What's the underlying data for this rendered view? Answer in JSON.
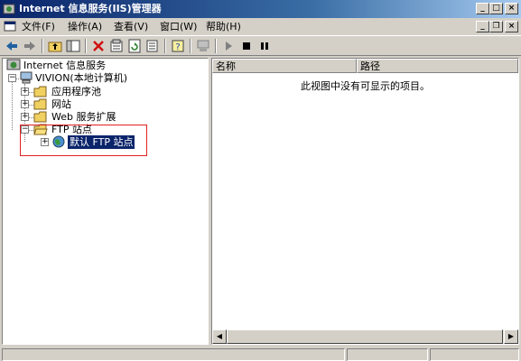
{
  "window": {
    "title": "Internet 信息服务(IIS)管理器"
  },
  "title_buttons": {
    "minimize": "_",
    "maximize": "□",
    "close": "×"
  },
  "menu": [
    "文件(F)",
    "操作(A)",
    "查看(V)",
    "窗口(W)",
    "帮助(H)"
  ],
  "mdi_buttons": {
    "minimize": "_",
    "restore": "❐",
    "close": "×"
  },
  "toolbar": {
    "icons": [
      "back-icon",
      "forward-icon",
      "up-folder-icon",
      "show-tree-icon",
      "delete-icon",
      "properties-icon",
      "refresh-icon",
      "export-list-icon",
      "help-icon",
      "computer-icon",
      "play-icon",
      "stop-icon",
      "pause-icon"
    ]
  },
  "tree": {
    "root": "Internet 信息服务",
    "computer": "VIVION(本地计算机)",
    "app_pools": "应用程序池",
    "websites": "网站",
    "web_ext": "Web 服务扩展",
    "ftp_sites": "FTP 站点",
    "default_ftp": "默认 FTP 站点",
    "expand_plus": "+",
    "expand_minus": "−"
  },
  "list": {
    "columns": [
      "名称",
      "路径"
    ],
    "empty_message": "此视图中没有可显示的项目。"
  },
  "scroll": {
    "left": "◀",
    "right": "▶"
  },
  "colors": {
    "title_start": "#0a246a",
    "title_end": "#a6caf0",
    "selection": "#0a246a",
    "highlight": "#e02020"
  }
}
